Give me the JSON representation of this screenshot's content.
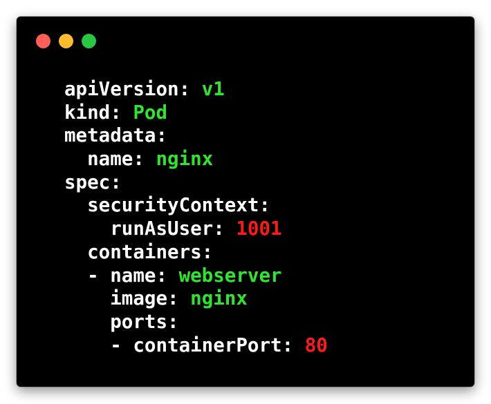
{
  "colors": {
    "window_bg": "#000000",
    "key": "#ffffff",
    "string": "#2ee62e",
    "number": "#ff1a1a",
    "traffic_close": "#ff5f57",
    "traffic_minimize": "#febc2e",
    "traffic_maximize": "#28c840"
  },
  "window_controls": [
    "close",
    "minimize",
    "maximize"
  ],
  "code_lines": [
    {
      "indent": "",
      "key": "apiVersion:",
      "value": "v1",
      "kind": "string"
    },
    {
      "indent": "",
      "key": "kind:",
      "value": "Pod",
      "kind": "string"
    },
    {
      "indent": "",
      "key": "metadata:",
      "value": "",
      "kind": "none"
    },
    {
      "indent": "  ",
      "key": "name:",
      "value": "nginx",
      "kind": "string"
    },
    {
      "indent": "",
      "key": "spec:",
      "value": "",
      "kind": "none"
    },
    {
      "indent": "  ",
      "key": "securityContext:",
      "value": "",
      "kind": "none"
    },
    {
      "indent": "    ",
      "key": "runAsUser:",
      "value": "1001",
      "kind": "number"
    },
    {
      "indent": "  ",
      "key": "containers:",
      "value": "",
      "kind": "none"
    },
    {
      "indent": "  ",
      "key": "- name:",
      "value": "webserver",
      "kind": "string"
    },
    {
      "indent": "    ",
      "key": "image:",
      "value": "nginx",
      "kind": "string"
    },
    {
      "indent": "    ",
      "key": "ports:",
      "value": "",
      "kind": "none"
    },
    {
      "indent": "    ",
      "key": "- containerPort:",
      "value": "80",
      "kind": "number"
    }
  ]
}
